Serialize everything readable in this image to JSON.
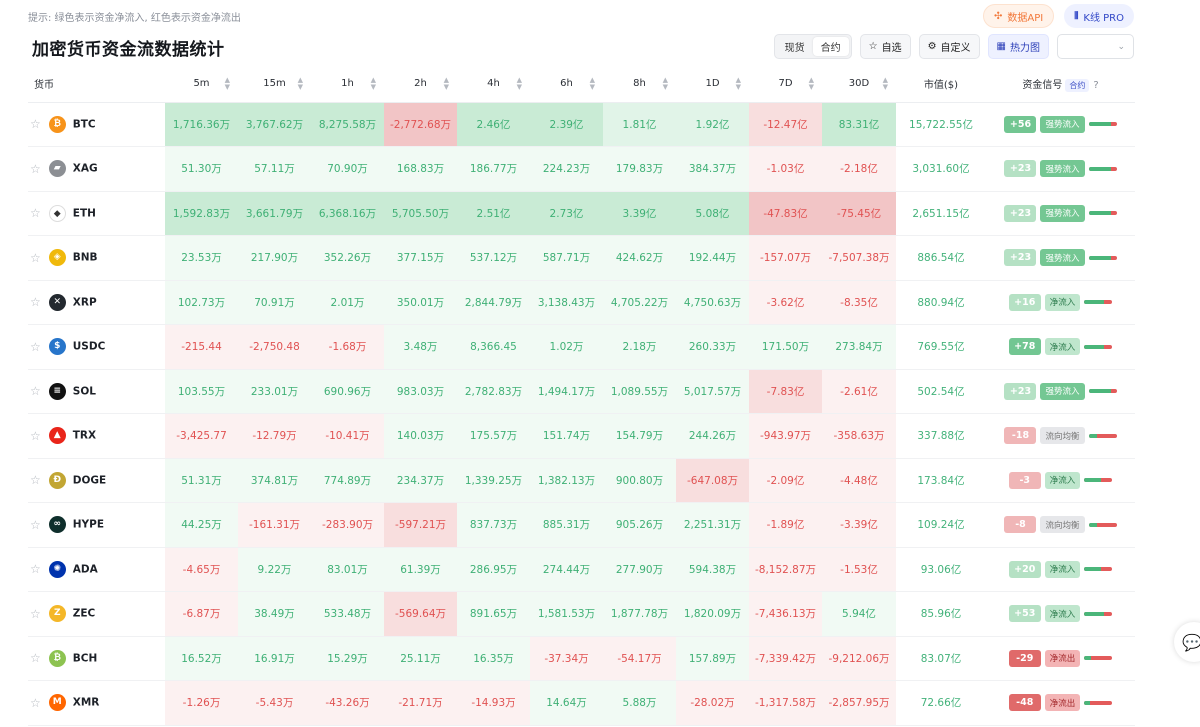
{
  "hint": "提示: 绿色表示资金净流入, 红色表示资金净流出",
  "api_label": "数据API",
  "kline_label": "K线 PRO",
  "title": "加密货币资金流数据统计",
  "seg": {
    "spot": "现货",
    "contract": "合约"
  },
  "buttons": {
    "favorite": "自选",
    "custom": "自定义",
    "heatmap": "热力图"
  },
  "columns": [
    "货币",
    "5m",
    "15m",
    "1h",
    "2h",
    "4h",
    "6h",
    "8h",
    "1D",
    "7D",
    "30D",
    "市值($)",
    "资金信号"
  ],
  "signal_tag": "合约",
  "signal_help": "?",
  "rows": [
    {
      "symbol": "BTC",
      "icon": "bitcoin-icon",
      "icon_color": "#f7931a",
      "glyph": "₿",
      "values": [
        "1,716.36万",
        "3,767.62万",
        "8,275.58万",
        "-2,772.68万",
        "2.46亿",
        "2.39亿",
        "1.81亿",
        "1.92亿",
        "-12.47亿",
        "83.31亿"
      ],
      "shade": [
        "g3",
        "g3",
        "g3",
        "r3",
        "g3",
        "g3",
        "g2",
        "g2",
        "r2",
        "g3"
      ],
      "cap": "15,722.55亿",
      "score": "+56",
      "score_style": "sg",
      "signal": "强势流入",
      "signal_style": "strong",
      "level": 0.8
    },
    {
      "symbol": "XAG",
      "icon": "silver-icon",
      "icon_color": "#8c8f94",
      "glyph": "▰",
      "values": [
        "51.30万",
        "57.11万",
        "70.90万",
        "168.83万",
        "186.77万",
        "224.23万",
        "179.83万",
        "384.37万",
        "-1.03亿",
        "-2.18亿"
      ],
      "shade": [
        "g1",
        "g1",
        "g1",
        "g1",
        "g1",
        "g1",
        "g1",
        "g1",
        "r1",
        "r1"
      ],
      "cap": "3,031.60亿",
      "score": "+23",
      "score_style": "lg",
      "signal": "强势流入",
      "signal_style": "strong",
      "level": 0.8
    },
    {
      "symbol": "ETH",
      "icon": "ethereum-icon",
      "icon_color": "#ffffff",
      "glyph": "◆",
      "values": [
        "1,592.83万",
        "3,661.79万",
        "6,368.16万",
        "5,705.50万",
        "2.51亿",
        "2.73亿",
        "3.39亿",
        "5.08亿",
        "-47.83亿",
        "-75.45亿"
      ],
      "shade": [
        "g3",
        "g3",
        "g3",
        "g3",
        "g3",
        "g3",
        "g3",
        "g3",
        "r3",
        "r3"
      ],
      "cap": "2,651.15亿",
      "score": "+23",
      "score_style": "lg",
      "signal": "强势流入",
      "signal_style": "strong",
      "level": 0.8
    },
    {
      "symbol": "BNB",
      "icon": "bnb-icon",
      "icon_color": "#f0b90b",
      "glyph": "◈",
      "values": [
        "23.53万",
        "217.90万",
        "352.26万",
        "377.15万",
        "537.12万",
        "587.71万",
        "424.62万",
        "192.44万",
        "-157.07万",
        "-7,507.38万"
      ],
      "shade": [
        "g1",
        "g1",
        "g1",
        "g1",
        "g1",
        "g1",
        "g1",
        "g1",
        "r1",
        "r1"
      ],
      "cap": "886.54亿",
      "score": "+23",
      "score_style": "lg",
      "signal": "强势流入",
      "signal_style": "strong",
      "level": 0.8
    },
    {
      "symbol": "XRP",
      "icon": "xrp-icon",
      "icon_color": "#23292f",
      "glyph": "✕",
      "values": [
        "102.73万",
        "70.91万",
        "2.01万",
        "350.01万",
        "2,844.79万",
        "3,138.43万",
        "4,705.22万",
        "4,750.63万",
        "-3.62亿",
        "-8.35亿"
      ],
      "shade": [
        "g1",
        "g1",
        "g1",
        "g1",
        "g1",
        "g1",
        "g1",
        "g1",
        "r1",
        "r1"
      ],
      "cap": "880.94亿",
      "score": "+16",
      "score_style": "lg",
      "signal": "净流入",
      "signal_style": "in",
      "level": 0.7
    },
    {
      "symbol": "USDC",
      "icon": "usdc-icon",
      "icon_color": "#2775ca",
      "glyph": "$",
      "values": [
        "-215.44",
        "-2,750.48",
        "-1.68万",
        "3.48万",
        "8,366.45",
        "1.02万",
        "2.18万",
        "260.33万",
        "171.50万",
        "273.84万"
      ],
      "shade": [
        "r1",
        "r1",
        "r1",
        "g1",
        "g1",
        "g1",
        "g1",
        "g1",
        "g1",
        "g1"
      ],
      "cap": "769.55亿",
      "score": "+78",
      "score_style": "sg",
      "signal": "净流入",
      "signal_style": "in",
      "level": 0.7
    },
    {
      "symbol": "SOL",
      "icon": "solana-icon",
      "icon_color": "#111111",
      "glyph": "≡",
      "values": [
        "103.55万",
        "233.01万",
        "690.96万",
        "983.03万",
        "2,782.83万",
        "1,494.17万",
        "1,089.55万",
        "5,017.57万",
        "-7.83亿",
        "-2.61亿"
      ],
      "shade": [
        "g1",
        "g1",
        "g1",
        "g1",
        "g1",
        "g1",
        "g1",
        "g1",
        "r2",
        "r1"
      ],
      "cap": "502.54亿",
      "score": "+23",
      "score_style": "lg",
      "signal": "强势流入",
      "signal_style": "strong",
      "level": 0.8
    },
    {
      "symbol": "TRX",
      "icon": "tron-icon",
      "icon_color": "#e9251a",
      "glyph": "▲",
      "values": [
        "-3,425.77",
        "-12.79万",
        "-10.41万",
        "140.03万",
        "175.57万",
        "151.74万",
        "154.79万",
        "244.26万",
        "-943.97万",
        "-358.63万"
      ],
      "shade": [
        "r1",
        "r1",
        "r1",
        "g1",
        "g1",
        "g1",
        "g1",
        "g1",
        "r1",
        "r1"
      ],
      "cap": "337.88亿",
      "score": "-18",
      "score_style": "lr",
      "signal": "流向均衡",
      "signal_style": "bal",
      "level": 0.3
    },
    {
      "symbol": "DOGE",
      "icon": "dogecoin-icon",
      "icon_color": "#c2a633",
      "glyph": "Ð",
      "values": [
        "51.31万",
        "374.81万",
        "774.89万",
        "234.37万",
        "1,339.25万",
        "1,382.13万",
        "900.80万",
        "-647.08万",
        "-2.09亿",
        "-4.48亿"
      ],
      "shade": [
        "g1",
        "g1",
        "g1",
        "g1",
        "g1",
        "g1",
        "g1",
        "r2",
        "r1",
        "r1"
      ],
      "cap": "173.84亿",
      "score": "-3",
      "score_style": "lr",
      "signal": "净流入",
      "signal_style": "in",
      "level": 0.6
    },
    {
      "symbol": "HYPE",
      "icon": "hyperliquid-icon",
      "icon_color": "#0f2f2c",
      "glyph": "∞",
      "values": [
        "44.25万",
        "-161.31万",
        "-283.90万",
        "-597.21万",
        "837.73万",
        "885.31万",
        "905.26万",
        "2,251.31万",
        "-1.89亿",
        "-3.39亿"
      ],
      "shade": [
        "g1",
        "r1",
        "r1",
        "r2",
        "g1",
        "g1",
        "g1",
        "g1",
        "r1",
        "r1"
      ],
      "cap": "109.24亿",
      "score": "-8",
      "score_style": "lr",
      "signal": "流向均衡",
      "signal_style": "bal",
      "level": 0.3
    },
    {
      "symbol": "ADA",
      "icon": "cardano-icon",
      "icon_color": "#0033ad",
      "glyph": "✺",
      "values": [
        "-4.65万",
        "9.22万",
        "83.01万",
        "61.39万",
        "286.95万",
        "274.44万",
        "277.90万",
        "594.38万",
        "-8,152.87万",
        "-1.53亿"
      ],
      "shade": [
        "r1",
        "g1",
        "g1",
        "g1",
        "g1",
        "g1",
        "g1",
        "g1",
        "r1",
        "r1"
      ],
      "cap": "93.06亿",
      "score": "+20",
      "score_style": "lg",
      "signal": "净流入",
      "signal_style": "in",
      "level": 0.6
    },
    {
      "symbol": "ZEC",
      "icon": "zcash-icon",
      "icon_color": "#f4b728",
      "glyph": "Z",
      "values": [
        "-6.87万",
        "38.49万",
        "533.48万",
        "-569.64万",
        "891.65万",
        "1,581.53万",
        "1,877.78万",
        "1,820.09万",
        "-7,436.13万",
        "5.94亿"
      ],
      "shade": [
        "r1",
        "g1",
        "g1",
        "r2",
        "g1",
        "g1",
        "g1",
        "g1",
        "r1",
        "g1"
      ],
      "cap": "85.96亿",
      "score": "+53",
      "score_style": "lg",
      "signal": "净流入",
      "signal_style": "in",
      "level": 0.7
    },
    {
      "symbol": "BCH",
      "icon": "bitcoin-cash-icon",
      "icon_color": "#8dc351",
      "glyph": "₿",
      "values": [
        "16.52万",
        "16.91万",
        "15.29万",
        "25.11万",
        "16.35万",
        "-37.34万",
        "-54.17万",
        "157.89万",
        "-7,339.42万",
        "-9,212.06万"
      ],
      "shade": [
        "g1",
        "g1",
        "g1",
        "g1",
        "g1",
        "r1",
        "r1",
        "g1",
        "r1",
        "r1"
      ],
      "cap": "83.07亿",
      "score": "-29",
      "score_style": "sr",
      "signal": "净流出",
      "signal_style": "out",
      "level": 0.25
    },
    {
      "symbol": "XMR",
      "icon": "monero-icon",
      "icon_color": "#ff6600",
      "glyph": "M",
      "values": [
        "-1.26万",
        "-5.43万",
        "-43.26万",
        "-21.71万",
        "-14.93万",
        "14.64万",
        "5.88万",
        "-28.02万",
        "-1,317.58万",
        "-2,857.95万"
      ],
      "shade": [
        "r1",
        "r1",
        "r1",
        "r1",
        "r1",
        "g1",
        "g1",
        "r1",
        "r1",
        "r1"
      ],
      "cap": "72.66亿",
      "score": "-48",
      "score_style": "sr",
      "signal": "净流出",
      "signal_style": "out",
      "level": 0.2
    }
  ]
}
